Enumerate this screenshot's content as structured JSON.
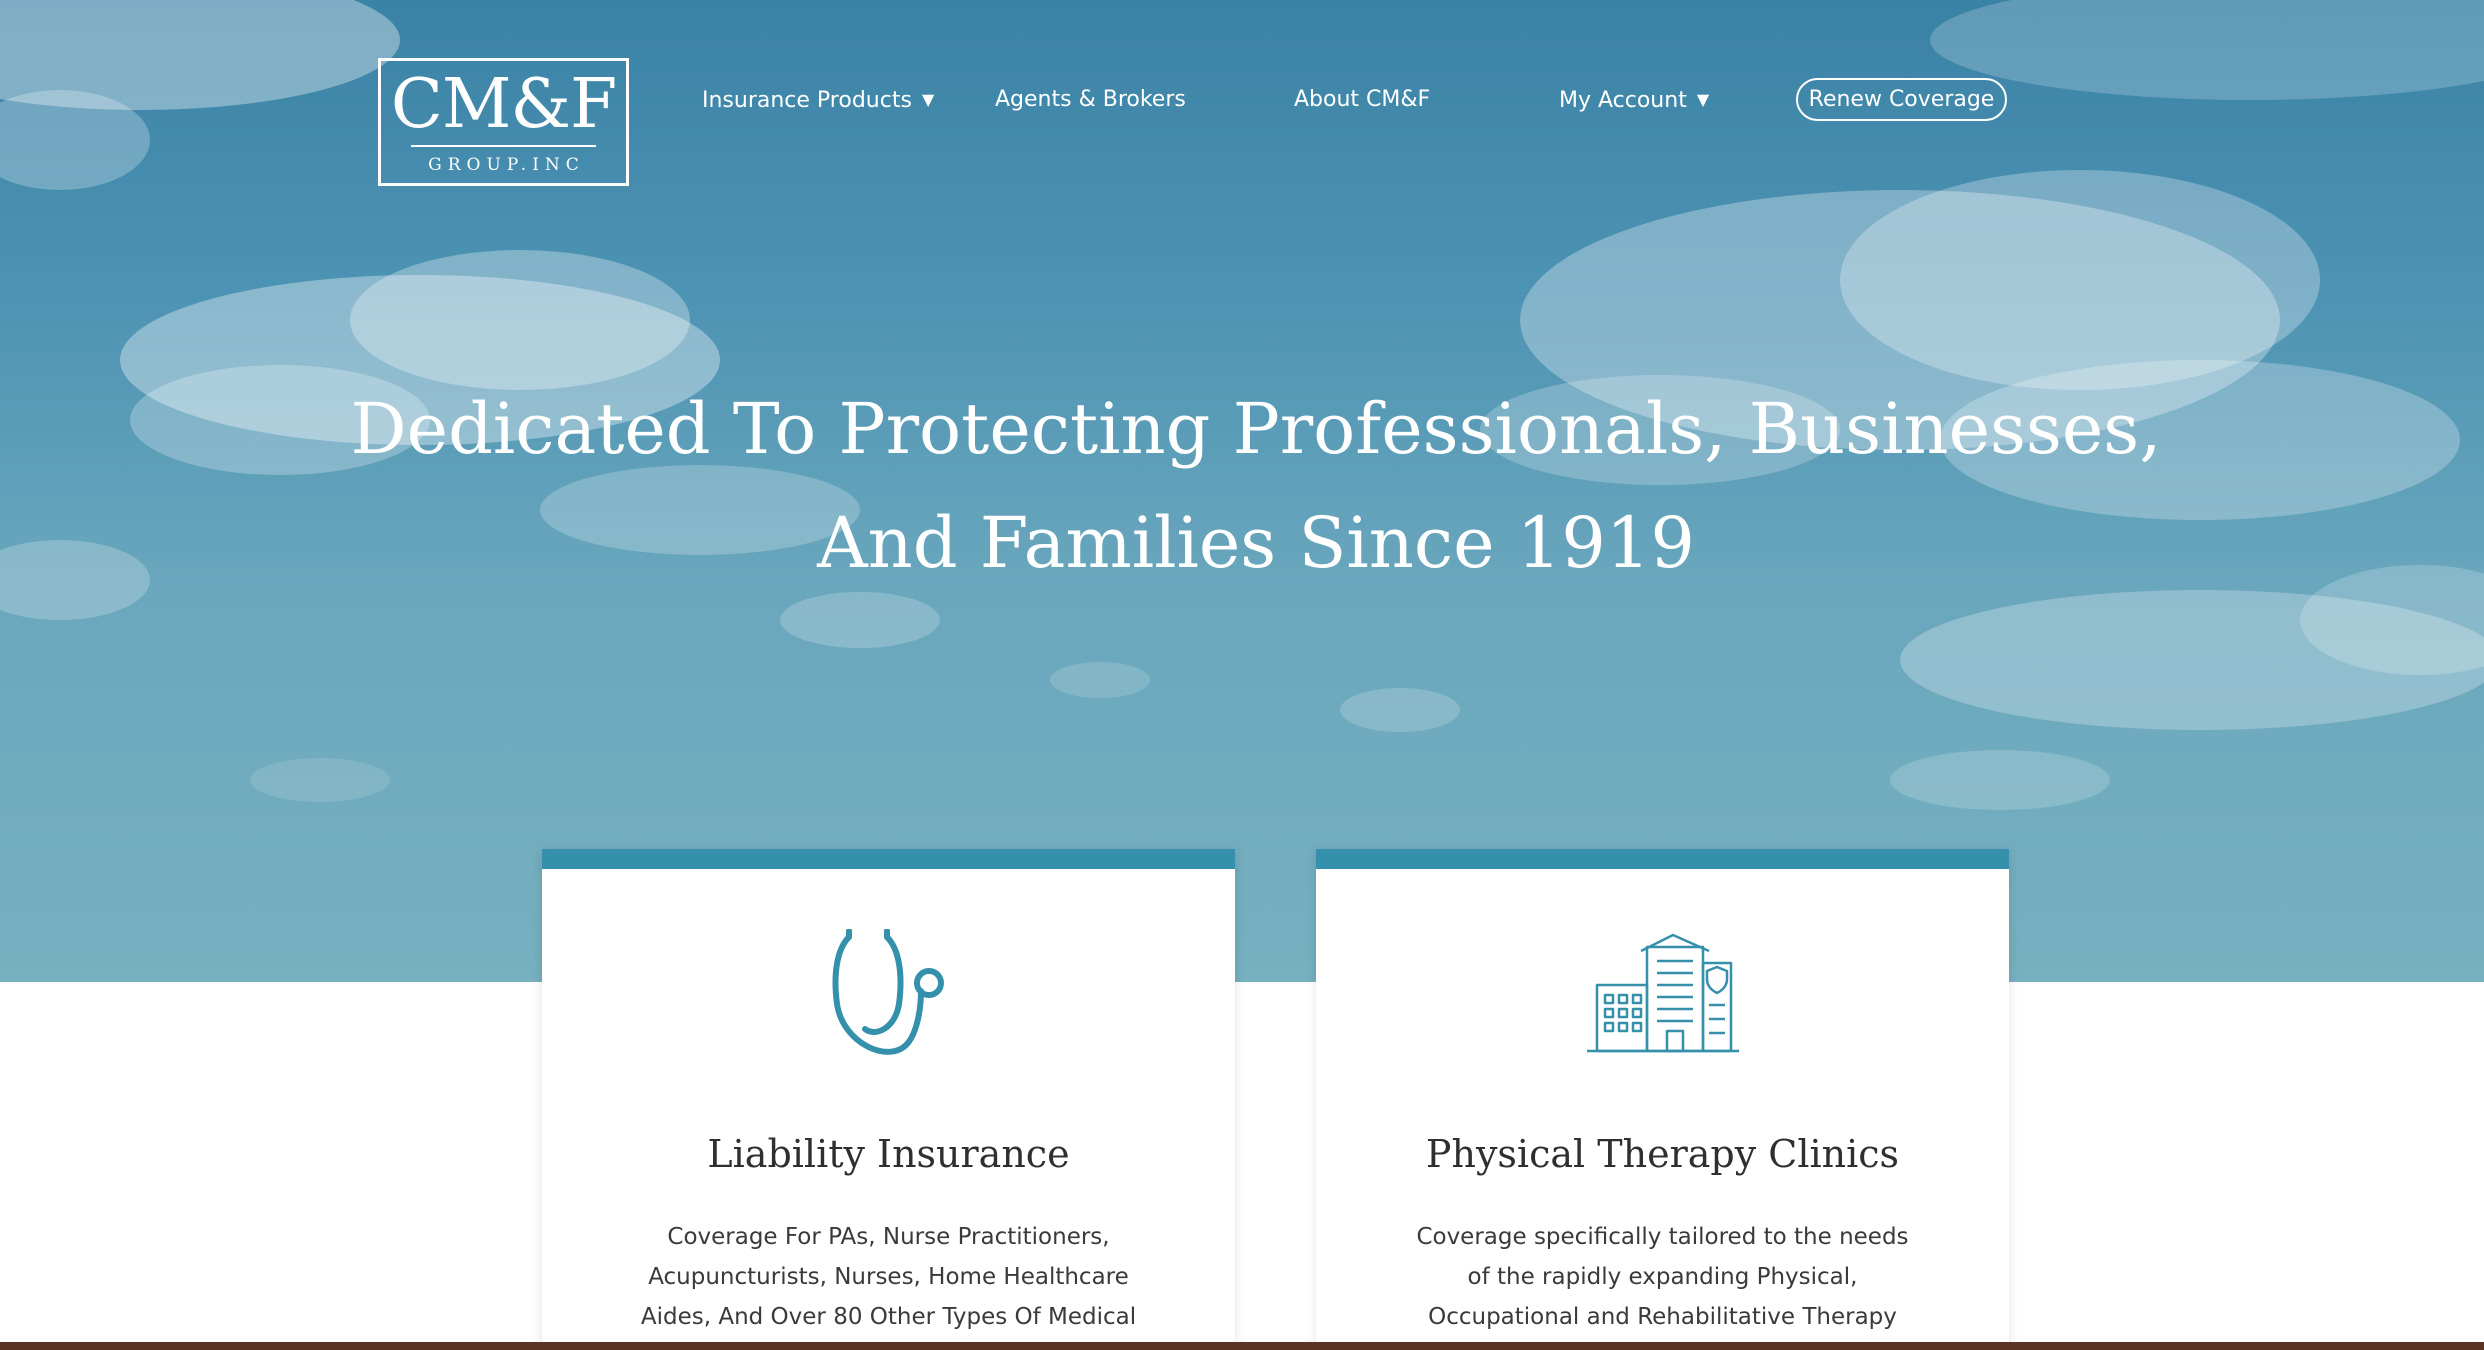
{
  "brand": {
    "logo_main": "CM&F",
    "logo_sub": "GROUP.INC"
  },
  "nav": {
    "items": [
      {
        "label": "Insurance Products",
        "has_dropdown": true
      },
      {
        "label": "Agents & Brokers",
        "has_dropdown": false
      },
      {
        "label": "About CM&F",
        "has_dropdown": false
      },
      {
        "label": "My Account",
        "has_dropdown": true
      }
    ],
    "cta_label": "Renew Coverage",
    "dropdown_icon": "caret-down-icon"
  },
  "hero": {
    "headline_line1": "Dedicated To Protecting Professionals, Businesses,",
    "headline_line2": "And Families Since 1919",
    "background": "sky-with-clouds"
  },
  "cards": [
    {
      "icon": "stethoscope-icon",
      "title": "Liability Insurance",
      "description": "Coverage For PAs, Nurse Practitioners, Acupuncturists, Nurses, Home Healthcare Aides, And Over 80 Other Types Of Medical Professionals And Groups."
    },
    {
      "icon": "clinic-building-icon",
      "title": "Physical Therapy Clinics",
      "description": "Coverage specifically tailored to the needs of the rapidly expanding Physical, Occupational and Rehabilitative Therapy markets."
    }
  ],
  "colors": {
    "accent": "#3590ab",
    "hero_top": "#3a82a6",
    "hero_bottom": "#77b0bf",
    "footer_bar": "#5c3424",
    "text_dark": "#2f2f2f"
  }
}
